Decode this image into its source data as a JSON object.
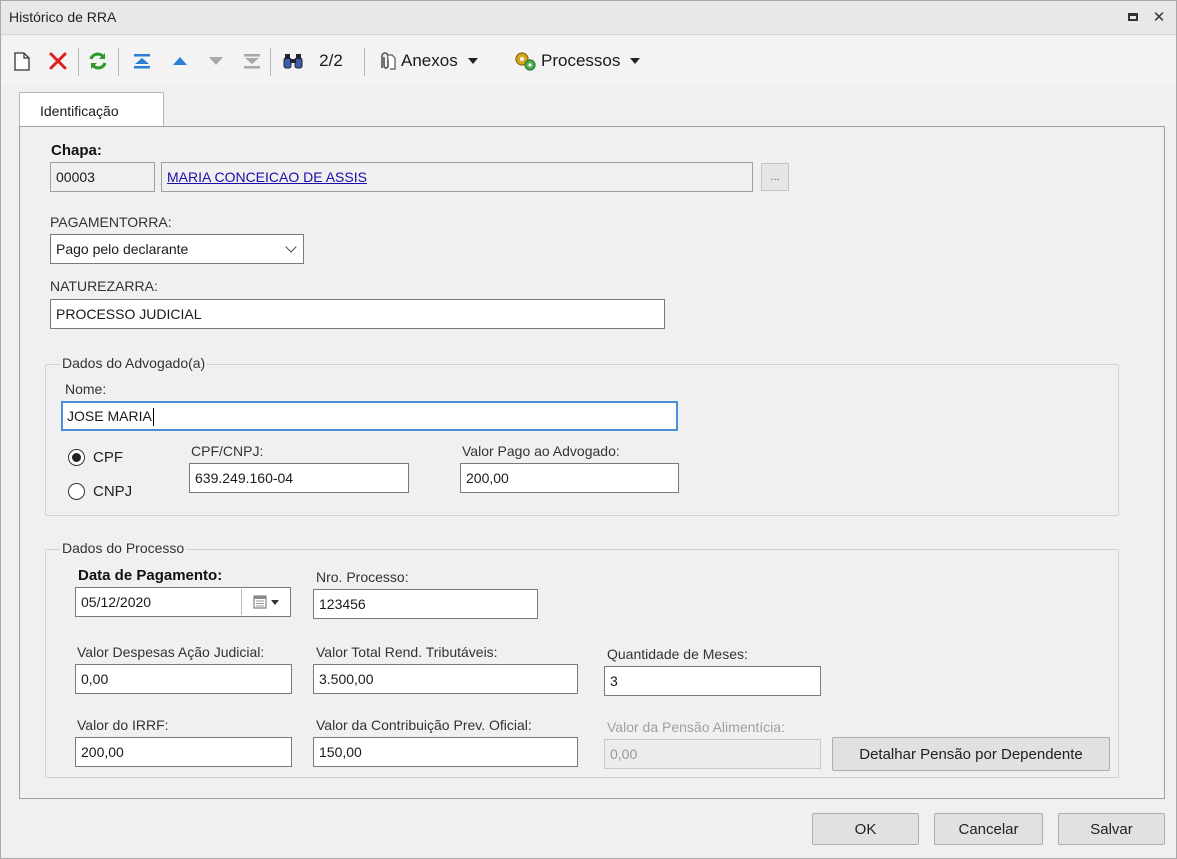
{
  "window": {
    "title": "Histórico de RRA"
  },
  "toolbar": {
    "record_counter": "2/2",
    "anexos_label": "Anexos",
    "processos_label": "Processos"
  },
  "tabs": [
    {
      "label": "Identificação",
      "active": true
    }
  ],
  "form": {
    "chapa": {
      "label": "Chapa:",
      "code": "00003",
      "name": "MARIA CONCEICAO DE ASSIS",
      "lookup_button": "..."
    },
    "pagamento": {
      "label": "PAGAMENTORRA:",
      "value": "Pago pelo declarante"
    },
    "natureza": {
      "label": "NATUREZARRA:",
      "value": "PROCESSO JUDICIAL"
    },
    "advogado": {
      "group_title": "Dados do Advogado(a)",
      "nome_label": "Nome:",
      "nome_value": "JOSE MARIA",
      "cpf_option": "CPF",
      "cnpj_option": "CNPJ",
      "selected": "CPF",
      "cpf_cnpj_label": "CPF/CNPJ:",
      "cpf_cnpj_value": "639.249.160-04",
      "valor_pago_label": "Valor Pago ao Advogado:",
      "valor_pago_value": "200,00"
    },
    "processo": {
      "group_title": "Dados do Processo",
      "data_pagamento_label": "Data de Pagamento:",
      "data_pagamento_value": "05/12/2020",
      "nro_processo_label": "Nro. Processo:",
      "nro_processo_value": "123456",
      "despesas_label": "Valor Despesas Ação Judicial:",
      "despesas_value": "0,00",
      "total_rend_label": "Valor Total Rend. Tributáveis:",
      "total_rend_value": "3.500,00",
      "qtd_meses_label": "Quantidade de Meses:",
      "qtd_meses_value": "3",
      "irrf_label": "Valor do IRRF:",
      "irrf_value": "200,00",
      "contrib_label": "Valor da Contribuição Prev. Oficial:",
      "contrib_value": "150,00",
      "pensao_label": "Valor da Pensão Alimentícia:",
      "pensao_value": "0,00",
      "detalhar_button": "Detalhar Pensão por Dependente"
    }
  },
  "footer": {
    "ok": "OK",
    "cancel": "Cancelar",
    "save": "Salvar"
  },
  "colors": {
    "delete_red": "#e02020",
    "refresh_green": "#2e9a2e",
    "nav_blue": "#2a7fd4",
    "link_blue": "#1a0dab",
    "focus_blue": "#4a90d9"
  }
}
